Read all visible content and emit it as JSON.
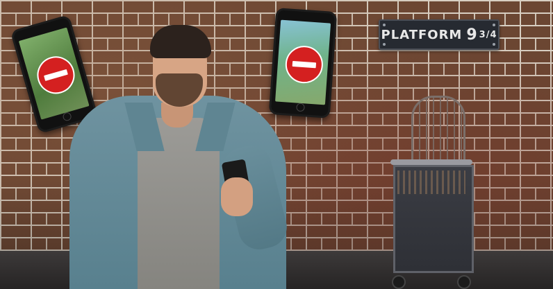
{
  "scene": {
    "description_kind": "photo-collage",
    "colors": {
      "brick": "#6b4632",
      "mortar": "#d8cfc2",
      "shirt": "#6f93a0",
      "sign_background": "#262a31",
      "no_entry_red": "#d42020"
    }
  },
  "sign": {
    "word": "PLATFORM",
    "number": "9",
    "fraction": "3/4"
  },
  "phones": [
    {
      "icon": "no-entry-icon",
      "screen": "game-map"
    },
    {
      "icon": "no-entry-icon",
      "screen": "game-map"
    }
  ]
}
